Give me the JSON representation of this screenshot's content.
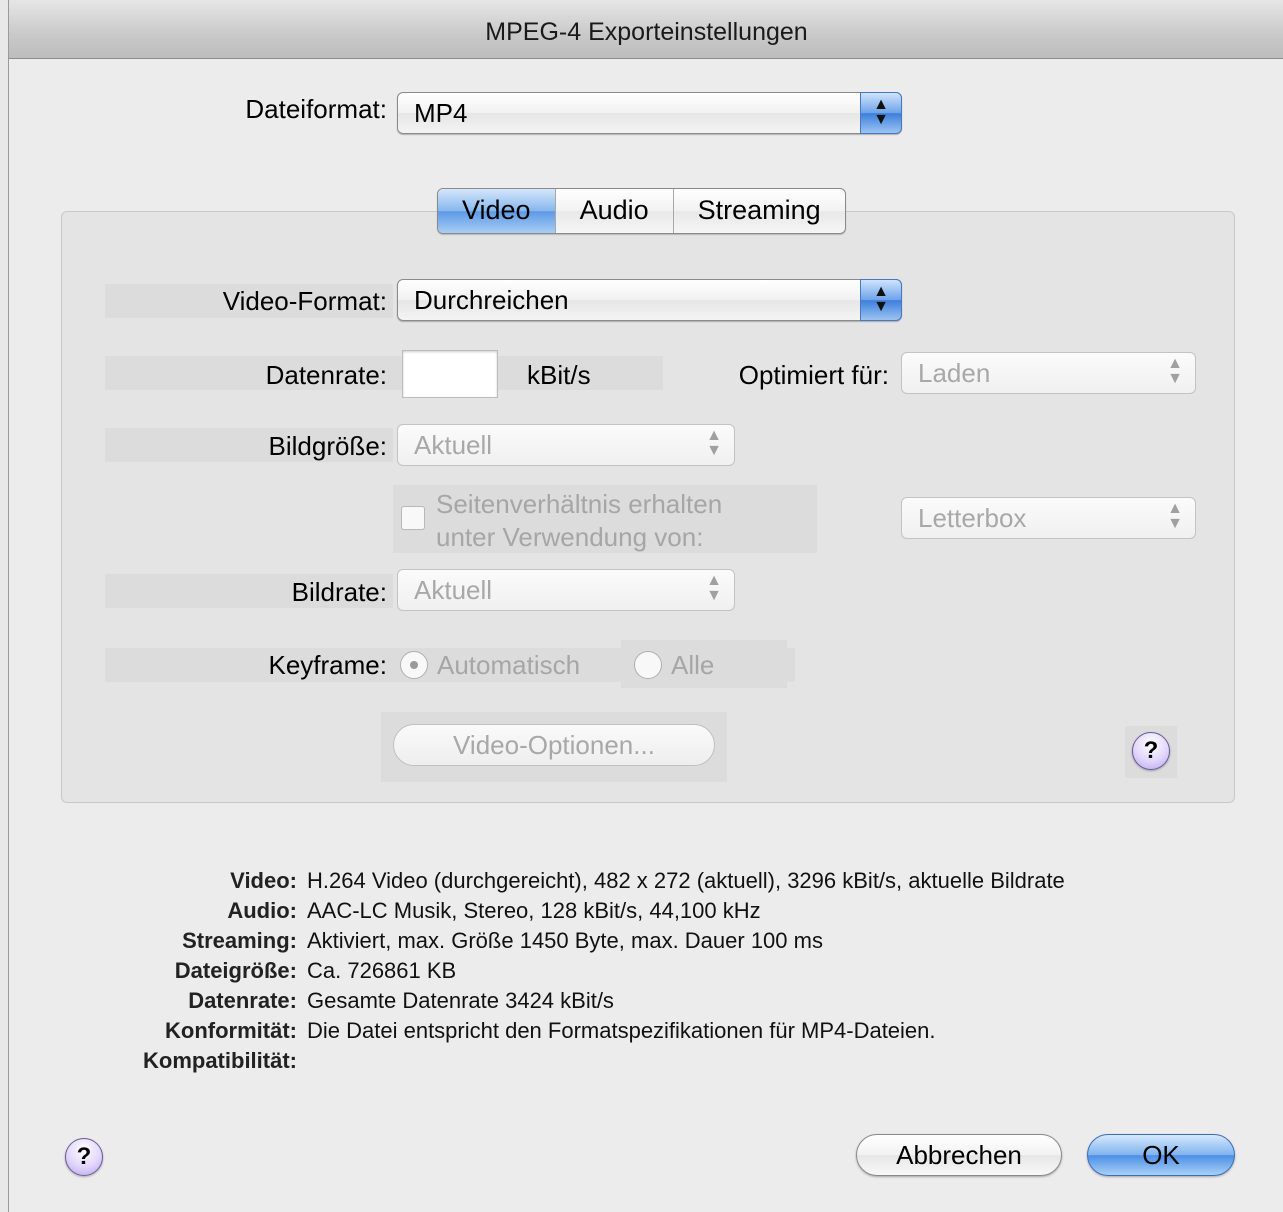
{
  "window": {
    "title": "MPEG-4 Exporteinstellungen"
  },
  "dateiformat": {
    "label": "Dateiformat:",
    "value": "MP4"
  },
  "tabs": [
    {
      "label": "Video",
      "active": true
    },
    {
      "label": "Audio",
      "active": false
    },
    {
      "label": "Streaming",
      "active": false
    }
  ],
  "video": {
    "format_label": "Video-Format:",
    "format_value": "Durchreichen",
    "datenrate_label": "Datenrate:",
    "datenrate_value": "",
    "datenrate_unit": "kBit/s",
    "optimiert_label": "Optimiert für:",
    "optimiert_value": "Laden",
    "bildgroesse_label": "Bildgröße:",
    "bildgroesse_value": "Aktuell",
    "seitenverhaeltnis_line1": "Seitenverhältnis erhalten",
    "seitenverhaeltnis_line2": "unter Verwendung von:",
    "letterbox_value": "Letterbox",
    "bildrate_label": "Bildrate:",
    "bildrate_value": "Aktuell",
    "keyframe_label": "Keyframe:",
    "keyframe_auto": "Automatisch",
    "keyframe_alle": "Alle",
    "optionen_button": "Video-Optionen..."
  },
  "help_glyph": "?",
  "summary": [
    {
      "key": "Video:",
      "value": "H.264 Video (durchgereicht), 482 x 272 (aktuell), 3296 kBit/s, aktuelle Bildrate"
    },
    {
      "key": "Audio:",
      "value": "AAC-LC Musik, Stereo, 128 kBit/s, 44,100 kHz"
    },
    {
      "key": "Streaming:",
      "value": "Aktiviert, max. Größe 1450 Byte, max. Dauer 100 ms"
    },
    {
      "key": "Dateigröße:",
      "value": "Ca. 726861 KB"
    },
    {
      "key": "Datenrate:",
      "value": "Gesamte Datenrate 3424 kBit/s"
    },
    {
      "key": "Konformität:",
      "value": "Die Datei entspricht den Formatspezifikationen für MP4-Dateien."
    },
    {
      "key": "Kompatibilität:",
      "value": ""
    }
  ],
  "buttons": {
    "cancel": "Abbrechen",
    "ok": "OK"
  }
}
